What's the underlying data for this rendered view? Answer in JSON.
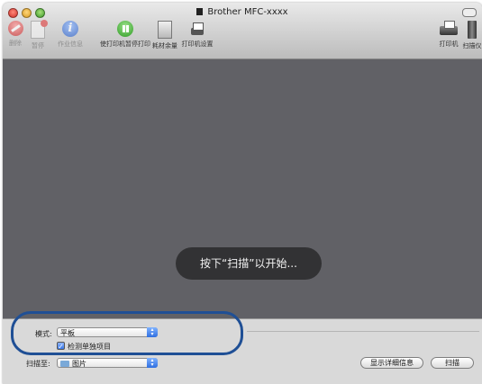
{
  "window": {
    "title": "Brother MFC-xxxx"
  },
  "toolbar": {
    "left_items": [
      {
        "label": "删除",
        "icon": "delete-icon"
      },
      {
        "label": "暂停",
        "icon": "pause-document-icon"
      },
      {
        "label": "作业信息",
        "icon": "info-icon"
      },
      {
        "label": "使打印机暂停打印",
        "icon": "resume-printer-icon"
      },
      {
        "label": "耗材余量",
        "icon": "supply-levels-icon"
      },
      {
        "label": "打印机设置",
        "icon": "printer-setup-icon"
      }
    ],
    "right_items": [
      {
        "label": "打印机",
        "icon": "printer-icon"
      },
      {
        "label": "扫描仪",
        "icon": "scanner-icon"
      }
    ]
  },
  "preview": {
    "message": "按下“扫描”以开始..."
  },
  "scan_settings": {
    "mode_label": "模式:",
    "mode_value": "平板",
    "detect_label": "检测单独项目",
    "detect_checked": true,
    "scan_to_label": "扫描至:",
    "scan_to_value": "图片"
  },
  "buttons": {
    "details": "显示详细信息",
    "scan": "扫描"
  },
  "colors": {
    "highlight": "#1f4f95",
    "preview_bg": "#616166",
    "accent": "#2f6fe0"
  }
}
